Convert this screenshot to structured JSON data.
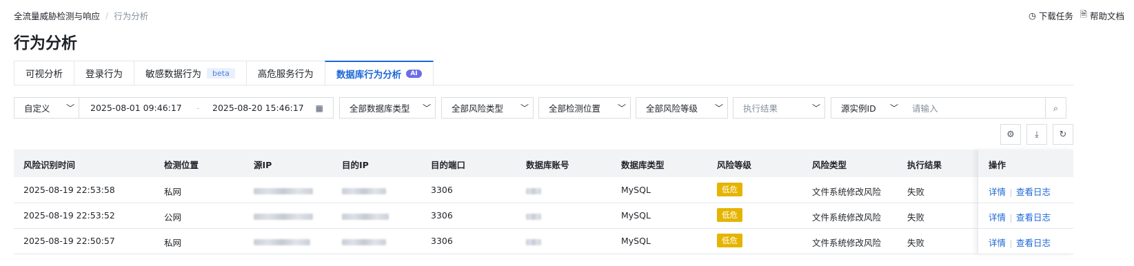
{
  "breadcrumb": {
    "parent": "全流量威胁检测与响应",
    "separator": "/",
    "current": "行为分析"
  },
  "top_links": {
    "download": "下载任务",
    "help": "帮助文档"
  },
  "page_title": "行为分析",
  "tabs": [
    {
      "label": "可视分析"
    },
    {
      "label": "登录行为"
    },
    {
      "label": "敏感数据行为",
      "badge": "beta"
    },
    {
      "label": "高危服务行为"
    },
    {
      "label": "数据库行为分析",
      "badge": "AI",
      "active": true
    }
  ],
  "filters": {
    "time_mode": "自定义",
    "date_start": "2025-08-01 09:46:17",
    "date_sep": "-",
    "date_end": "2025-08-20 15:46:17",
    "db_type": "全部数据库类型",
    "risk_type": "全部风险类型",
    "detect_location": "全部检测位置",
    "risk_level": "全部风险等级",
    "exec_result": "执行结果",
    "source_id_field": "源实例ID",
    "search_placeholder": "请输入"
  },
  "icons": {
    "search": "search-icon",
    "settings": "gear-icon",
    "download": "download-icon",
    "refresh": "refresh-icon",
    "calendar": "calendar-icon",
    "clock": "clock-icon",
    "doc": "document-icon"
  },
  "colors": {
    "accent": "#1c66d6",
    "low_risk": "#e5b400"
  },
  "table": {
    "columns": [
      "风险识别时间",
      "检测位置",
      "源IP",
      "目的IP",
      "目的端口",
      "数据库账号",
      "数据库类型",
      "风险等级",
      "风险类型",
      "执行结果",
      "操作"
    ],
    "rows": [
      {
        "time": "2025-08-19 22:53:58",
        "location": "私网",
        "port": "3306",
        "db_type": "MySQL",
        "risk": "低危",
        "risk_type": "文件系统修改风险",
        "result": "失败"
      },
      {
        "time": "2025-08-19 22:53:52",
        "location": "公网",
        "port": "3306",
        "db_type": "MySQL",
        "risk": "低危",
        "risk_type": "文件系统修改风险",
        "result": "失败"
      },
      {
        "time": "2025-08-19 22:50:57",
        "location": "私网",
        "port": "3306",
        "db_type": "MySQL",
        "risk": "低危",
        "risk_type": "文件系统修改风险",
        "result": "失败"
      }
    ],
    "action_detail": "详情",
    "action_log": "查看日志"
  }
}
